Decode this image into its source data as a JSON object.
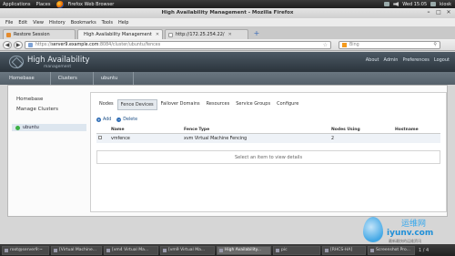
{
  "gnome_panel": {
    "menus": [
      "Applications",
      "Places",
      "Firefox Web Browser"
    ],
    "clock": "Wed 15:05",
    "user": "kiosk"
  },
  "window": {
    "title": "High Availability Management - Mozilla Firefox",
    "controls": [
      "–",
      "□",
      "✕"
    ]
  },
  "menubar": [
    "File",
    "Edit",
    "View",
    "History",
    "Bookmarks",
    "Tools",
    "Help"
  ],
  "tabs": [
    {
      "label": "Restore Session",
      "icon": "restore-icon"
    },
    {
      "label": "High Availability Management",
      "icon": "page-icon",
      "active": true
    },
    {
      "label": "http://172.25.254.22/",
      "icon": "blank-page-icon"
    }
  ],
  "navbar": {
    "back": "◀",
    "forward": "▶",
    "url_prefix": "https://",
    "url_host": "server9.example.com",
    "url_rest": ":8084/cluster/ubuntu/fences",
    "search_engine": "Bing",
    "search_placeholder": "Bing"
  },
  "app": {
    "title": "High Availability",
    "subtitle": "management",
    "links": [
      "About",
      "Admin",
      "Preferences",
      "Logout"
    ]
  },
  "breadcrumbs": [
    "Homebase",
    "Clusters",
    "ubuntu"
  ],
  "sidebar": {
    "links": [
      "Homebase",
      "Manage Clusters"
    ],
    "clusters": [
      {
        "name": "ubuntu",
        "status_color": "#3cb043"
      }
    ]
  },
  "main": {
    "tabs": [
      "Nodes",
      "Fence Devices",
      "Failover Domains",
      "Resources",
      "Service Groups",
      "Configure"
    ],
    "active_tab": "Fence Devices",
    "actions": [
      {
        "label": "Add",
        "icon": "plus-icon"
      },
      {
        "label": "Delete",
        "icon": "minus-icon"
      }
    ],
    "table": {
      "columns": [
        "Name",
        "Fence Type",
        "Nodes Using",
        "Hostname"
      ],
      "rows": [
        {
          "name": "vmfence",
          "type": "xvm Virtual Machine Fencing",
          "nodes": "2",
          "hostname": ""
        }
      ]
    },
    "empty_note": "Select an item to view details"
  },
  "taskbar": {
    "items": [
      {
        "label": "root@server9:~",
        "active": false
      },
      {
        "label": "[Virtual Machine...",
        "active": false
      },
      {
        "label": "[vm4 Virtual Ma...",
        "active": false
      },
      {
        "label": "[vm9 Virtual Ma...",
        "active": false
      },
      {
        "label": "High Availability...",
        "active": true
      },
      {
        "label": "pic",
        "active": false
      },
      {
        "label": "[RHCS-HA]",
        "active": false
      },
      {
        "label": "Screenshot Pro...",
        "active": false
      }
    ],
    "workspace": "1 / 4"
  },
  "watermark": {
    "cn": "运维网",
    "domain": "iyunv.com",
    "tagline": "最新最快的运维资讯"
  }
}
